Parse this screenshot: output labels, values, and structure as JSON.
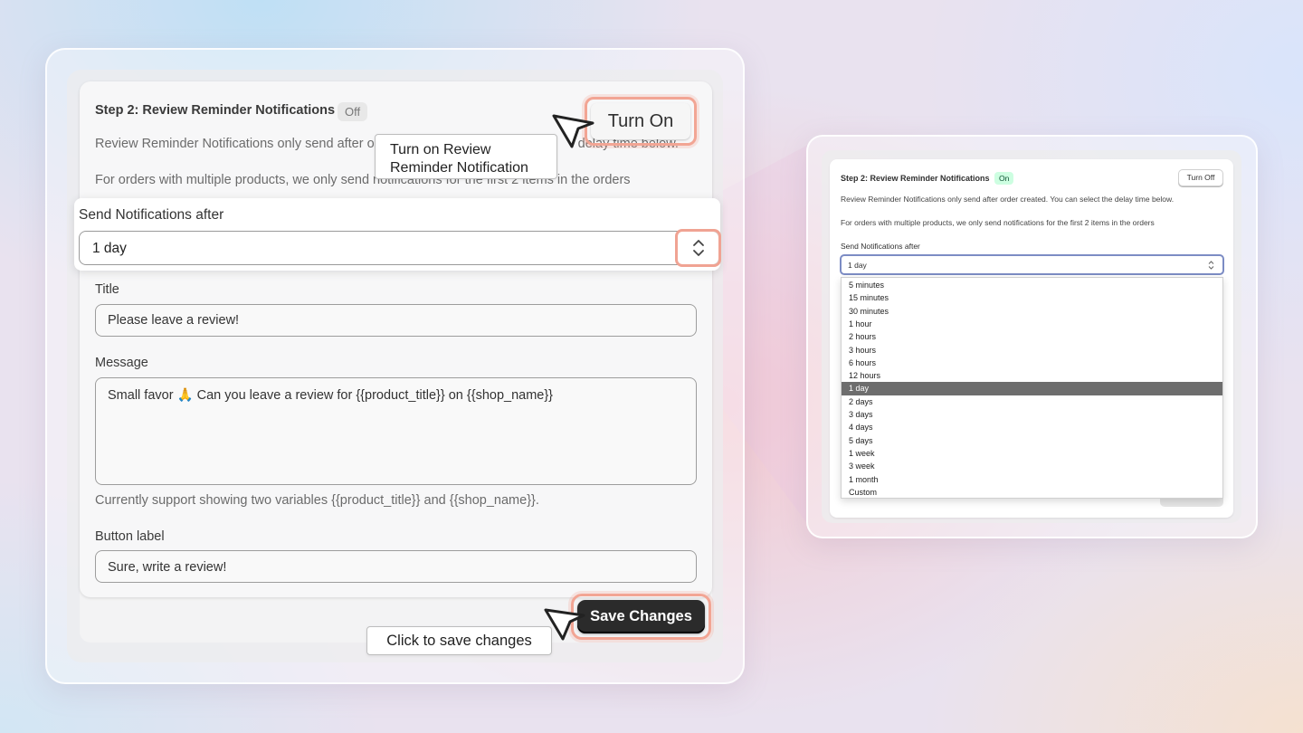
{
  "left_panel": {
    "title": "Step 2: Review Reminder Notifications",
    "status_badge": "Off",
    "turn_on_label": "Turn On",
    "description_1": "Review Reminder Notifications only send after o",
    "description_1_tail": "delay time below.",
    "description_2": "For orders with multiple products, we only send notifications for the first 2 items in the orders",
    "send_after": {
      "label": "Send Notifications after",
      "value": "1 day"
    },
    "title_field": {
      "label": "Title",
      "value": "Please leave a review!"
    },
    "message_field": {
      "label": "Message",
      "value": "Small favor 🙏 Can you leave a review for {{product_title}} on {{shop_name}}"
    },
    "help_text": "Currently support showing two variables {{product_title}} and {{shop_name}}.",
    "button_label_field": {
      "label": "Button label",
      "value": "Sure, write a review!"
    },
    "save_label": "Save Changes"
  },
  "annotations": {
    "turn_on_tooltip_line1": "Turn on Review",
    "turn_on_tooltip_line2": "Reminder Notification",
    "save_tooltip": "Click to save changes"
  },
  "right_panel": {
    "title": "Step 2: Review Reminder Notifications",
    "status_badge": "On",
    "turn_off_label": "Turn Off",
    "description_1": "Review Reminder Notifications only send after order created. You can select the delay time below.",
    "description_2": "For orders with multiple products, we only send notifications for the first 2 items in the orders",
    "send_after_label": "Send Notifications after",
    "send_after_value": "1 day",
    "options": [
      "5 minutes",
      "15 minutes",
      "30 minutes",
      "1 hour",
      "2 hours",
      "3 hours",
      "6 hours",
      "12 hours",
      "1 day",
      "2 days",
      "3 days",
      "4 days",
      "5 days",
      "1 week",
      "3 week",
      "1 month",
      "Custom"
    ],
    "selected_option": "1 day"
  },
  "colors": {
    "highlight": "#f2a594",
    "save_button": "#2b2b2b",
    "on_badge": "#cdfee1",
    "select_focus": "#7c8cc4",
    "selected_option": "#6d6d6d"
  }
}
